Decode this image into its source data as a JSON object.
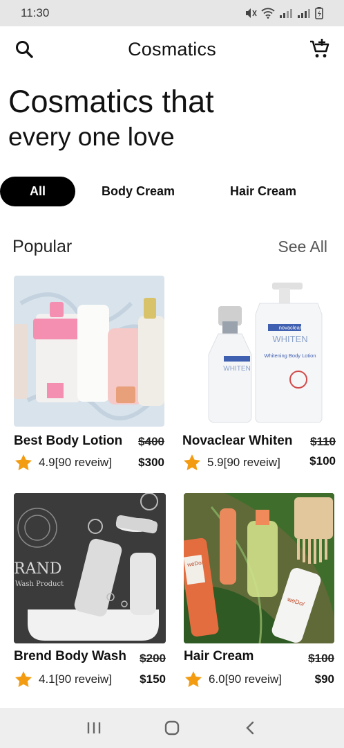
{
  "status": {
    "time": "11:30"
  },
  "header": {
    "title": "Cosmatics",
    "search_icon": "search-icon",
    "cart_icon": "add-to-cart-icon"
  },
  "hero": {
    "line1": "Cosmatics that",
    "line2": "every one love"
  },
  "filters": [
    {
      "label": "All",
      "active": true
    },
    {
      "label": "Body Cream",
      "active": false
    },
    {
      "label": "Hair Cream",
      "active": false
    }
  ],
  "section": {
    "title": "Popular",
    "see_all": "See All"
  },
  "products": [
    {
      "name": "Best Body Lotion",
      "old_price": "$400",
      "price": "$300",
      "rating": "4.9[90 reveiw]"
    },
    {
      "name": "Novaclear Whiten",
      "old_price": "$110",
      "price": "$100",
      "rating": "5.9[90 reveiw]"
    },
    {
      "name": "Brend Body Wash",
      "old_price": "$200",
      "price": "$150",
      "rating": "4.1[90 reveiw]"
    },
    {
      "name": "Hair Cream",
      "old_price": "$100",
      "price": "$90",
      "rating": "6.0[90 reveiw]"
    }
  ],
  "image_labels": {
    "lotion_brand": "novaclear",
    "lotion_line": "WHITEN",
    "lotion_sub": "Whitening Body Lotion",
    "wash_brand": "RAND",
    "wash_sub": "Wash Product",
    "hair_brand": "weDo/"
  },
  "colors": {
    "accent_star": "#f39c12",
    "chip_active_bg": "#000000"
  }
}
